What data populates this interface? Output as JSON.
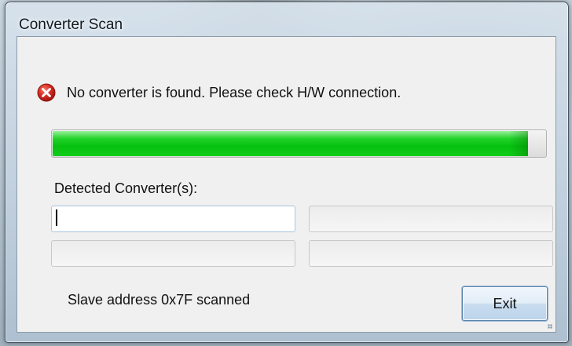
{
  "window": {
    "title": "Converter Scan"
  },
  "message": {
    "icon": "error-icon",
    "icon_color": "#c82020",
    "text": "No converter is found. Please check H/W connection."
  },
  "progress": {
    "value_percent": 100,
    "fill_color": "#06c10f"
  },
  "detected": {
    "label": "Detected Converter(s):",
    "fields": [
      "",
      "",
      "",
      ""
    ]
  },
  "status": {
    "text": "Slave address 0x7F scanned"
  },
  "buttons": {
    "exit_label": "Exit"
  }
}
